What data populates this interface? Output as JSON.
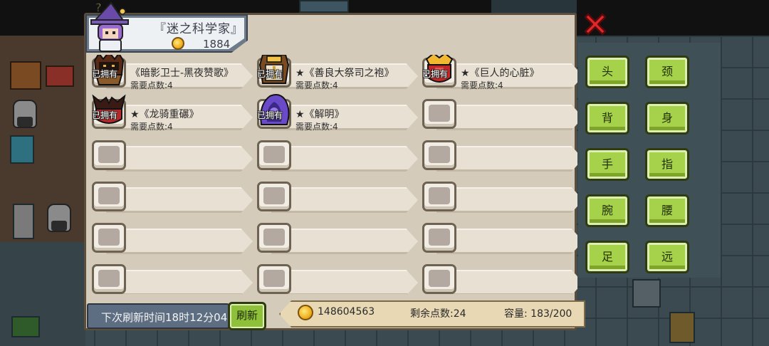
{
  "merchant": {
    "title": "『迷之科学家』",
    "coins": "1884"
  },
  "shop": {
    "items": [
      {
        "owned": "已拥有",
        "name": "《暗影卫士-黑夜赞歌》",
        "cost": "需要点数:4",
        "icon": "dark-helmet-icon"
      },
      {
        "owned": "已拥有",
        "name": "★《善良大祭司之袍》",
        "cost": "需要点数:4",
        "icon": "priest-robe-icon"
      },
      {
        "owned": "已拥有",
        "name": "★《巨人的心脏》",
        "cost": "需要点数:4",
        "icon": "giant-heart-icon"
      },
      {
        "owned": "已拥有",
        "name": "★《龙骑重碾》",
        "cost": "需要点数:4",
        "icon": "dragon-armor-icon"
      },
      {
        "owned": "已拥有",
        "name": "★《解明》",
        "cost": "需要点数:4",
        "icon": "purple-hood-icon"
      }
    ],
    "empty_slots": 13
  },
  "footer": {
    "refresh_timer": "下次刷新时间18时12分04秒",
    "refresh_button": "刷新",
    "coins": "148604563",
    "points": "剩余点数:24",
    "capacity": "容量: 183/200"
  },
  "categories": [
    {
      "id": "head",
      "label": "头"
    },
    {
      "id": "neck",
      "label": "颈"
    },
    {
      "id": "back",
      "label": "背"
    },
    {
      "id": "body",
      "label": "身"
    },
    {
      "id": "hand",
      "label": "手"
    },
    {
      "id": "finger",
      "label": "指"
    },
    {
      "id": "wrist",
      "label": "腕"
    },
    {
      "id": "waist",
      "label": "腰"
    },
    {
      "id": "foot",
      "label": "足"
    },
    {
      "id": "ranged",
      "label": "远"
    }
  ],
  "colors": {
    "category_button": "#a5d24a",
    "close_button": "#e0282a",
    "panel": "#d4cbbb",
    "ribbon": "#e8d8b4"
  }
}
